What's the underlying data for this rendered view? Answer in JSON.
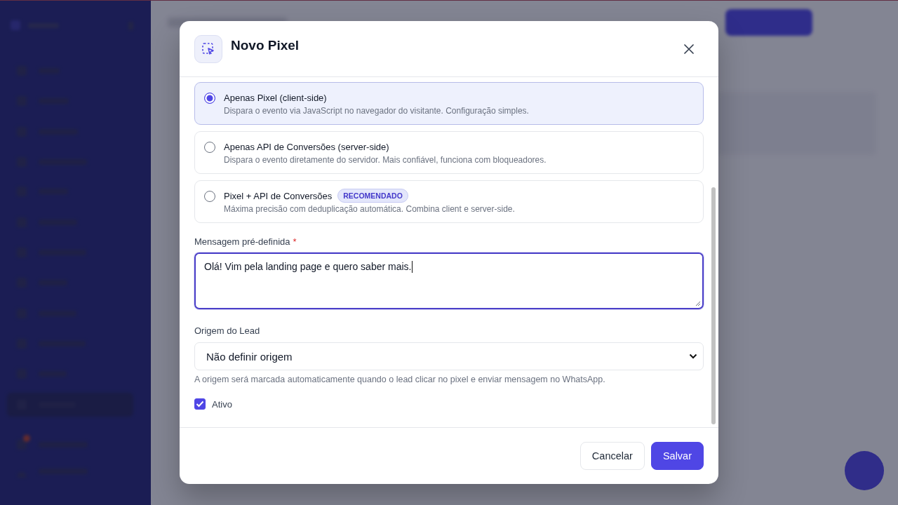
{
  "dialog": {
    "title": "Novo Pixel"
  },
  "send_modes": [
    {
      "title": "Apenas Pixel (client-side)",
      "description": "Dispara o evento via JavaScript no navegador do visitante. Configuração simples.",
      "selected": true
    },
    {
      "title": "Apenas API de Conversões (server-side)",
      "description": "Dispara o evento diretamente do servidor. Mais confiável, funciona com bloqueadores.",
      "selected": false
    },
    {
      "title": "Pixel + API de Conversões",
      "badge": "RECOMENDADO",
      "description": "Máxima precisão com deduplicação automática. Combina client e server-side.",
      "selected": false
    }
  ],
  "message_field": {
    "label": "Mensagem pré-definida",
    "required_mark": "*",
    "value": "Olá! Vim pela landing page e quero saber mais."
  },
  "lead_origin": {
    "label": "Origem do Lead",
    "value": "Não definir origem",
    "hint": "A origem será marcada automaticamente quando o lead clicar no pixel e enviar mensagem no WhatsApp."
  },
  "active": {
    "label": "Ativo",
    "checked": true
  },
  "buttons": [
    {
      "label": "Cancelar",
      "kind": "secondary"
    },
    {
      "label": "Salvar",
      "kind": "primary"
    }
  ]
}
